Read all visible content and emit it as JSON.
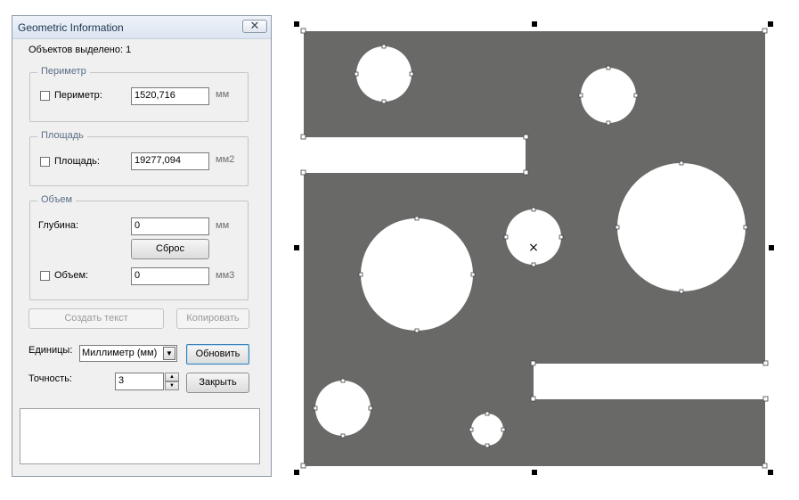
{
  "window": {
    "title": "Geometric Information",
    "close_glyph": "✕"
  },
  "selected_label": "Объектов выделено: 1",
  "perimeter": {
    "legend": "Периметр",
    "checkbox_label": "Периметр:",
    "checked": false,
    "value": "1520,716",
    "unit": "мм"
  },
  "area": {
    "legend": "Площадь",
    "checkbox_label": "Площадь:",
    "checked": false,
    "value": "19277,094",
    "unit": "мм2"
  },
  "volume": {
    "legend": "Объем",
    "depth_label": "Глубина:",
    "depth_value": "0",
    "depth_unit": "мм",
    "reset_button": "Сброс",
    "checkbox_label": "Объем:",
    "checked": false,
    "value": "0",
    "unit": "мм3"
  },
  "buttons": {
    "create_text": "Создать текст",
    "copy": "Копировать",
    "update": "Обновить",
    "close": "Закрыть"
  },
  "units": {
    "label": "Единицы:",
    "selected": "Миллиметр (мм)"
  },
  "precision": {
    "label": "Точность:",
    "value": "3"
  },
  "output_text": "",
  "drawing": {
    "fill_color": "#696968",
    "hole_color": "#ffffff",
    "center_mark": "×"
  }
}
